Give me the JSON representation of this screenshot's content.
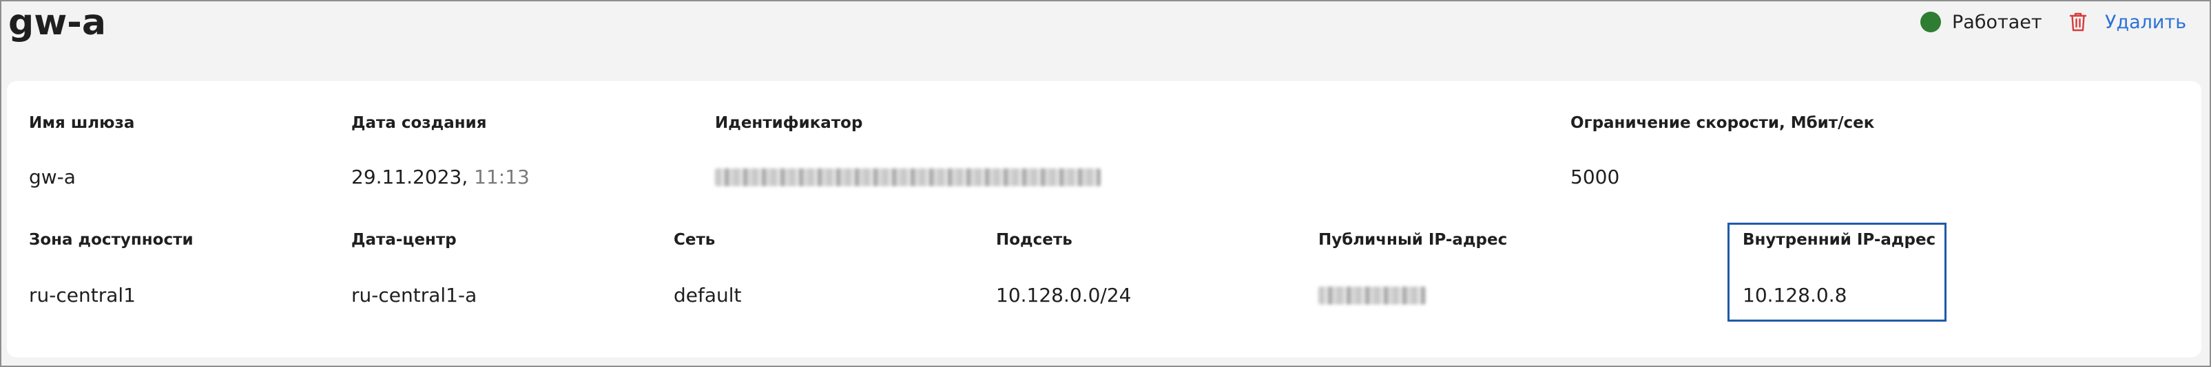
{
  "header": {
    "title": "gw-a",
    "status_label": "Работает",
    "status_color": "#2e7d32",
    "delete_label": "Удалить",
    "accent_color": "#2b72d8"
  },
  "details": {
    "row1": {
      "name_label": "Имя шлюза",
      "name_value": "gw-a",
      "created_label": "Дата создания",
      "created_date": "29.11.2023,",
      "created_time": "11:13",
      "id_label": "Идентификатор",
      "id_value_redacted": true,
      "speed_label": "Ограничение скорости, Мбит/сек",
      "speed_value": "5000"
    },
    "row2": {
      "zone_label": "Зона доступности",
      "zone_value": "ru-central1",
      "dc_label": "Дата-центр",
      "dc_value": "ru-central1-a",
      "network_label": "Сеть",
      "network_value": "default",
      "subnet_label": "Подсеть",
      "subnet_value": "10.128.0.0/24",
      "public_ip_label": "Публичный IP-адрес",
      "public_ip_redacted": true,
      "internal_ip_label": "Внутренний IP-адрес",
      "internal_ip_value": "10.128.0.8"
    }
  },
  "icons": {
    "status": "status-dot-icon",
    "delete": "trash-icon"
  }
}
